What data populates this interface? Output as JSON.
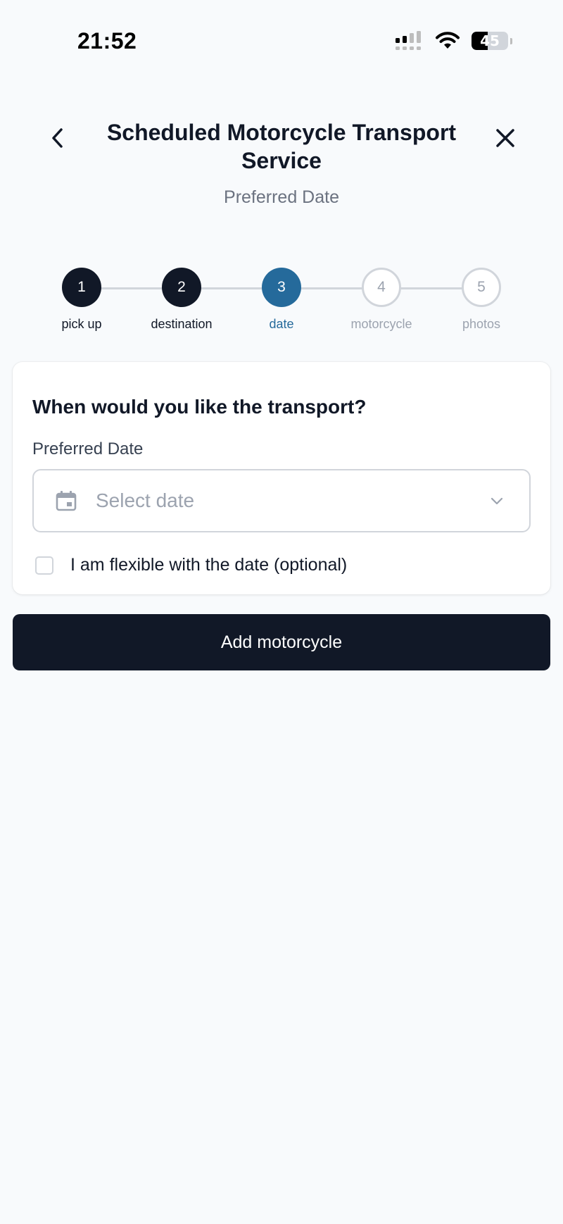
{
  "status_bar": {
    "time": "21:52",
    "battery_level": "45",
    "icons": [
      "signal-icon",
      "wifi-icon",
      "battery-icon"
    ]
  },
  "header": {
    "title": "Scheduled Motorcycle Transport Service",
    "subtitle": "Preferred Date",
    "back_icon": "chevron-left-icon",
    "close_icon": "close-icon"
  },
  "stepper": {
    "current_step": 3,
    "steps": [
      {
        "number": "1",
        "label": "pick up",
        "state": "done"
      },
      {
        "number": "2",
        "label": "destination",
        "state": "done"
      },
      {
        "number": "3",
        "label": "date",
        "state": "active"
      },
      {
        "number": "4",
        "label": "motorcycle",
        "state": "todo"
      },
      {
        "number": "5",
        "label": "photos",
        "state": "todo"
      }
    ]
  },
  "form": {
    "heading": "When would you like the transport?",
    "date_label": "Preferred Date",
    "date_placeholder": "Select date",
    "date_value": "",
    "flexible_label": "I am flexible with the date (optional)",
    "flexible_checked": false
  },
  "actions": {
    "primary_label": "Add motorcycle"
  },
  "colors": {
    "background": "#f8fafc",
    "primary": "#111827",
    "active_step": "#256a9b",
    "muted": "#9ca3af",
    "border": "#d1d5db"
  }
}
